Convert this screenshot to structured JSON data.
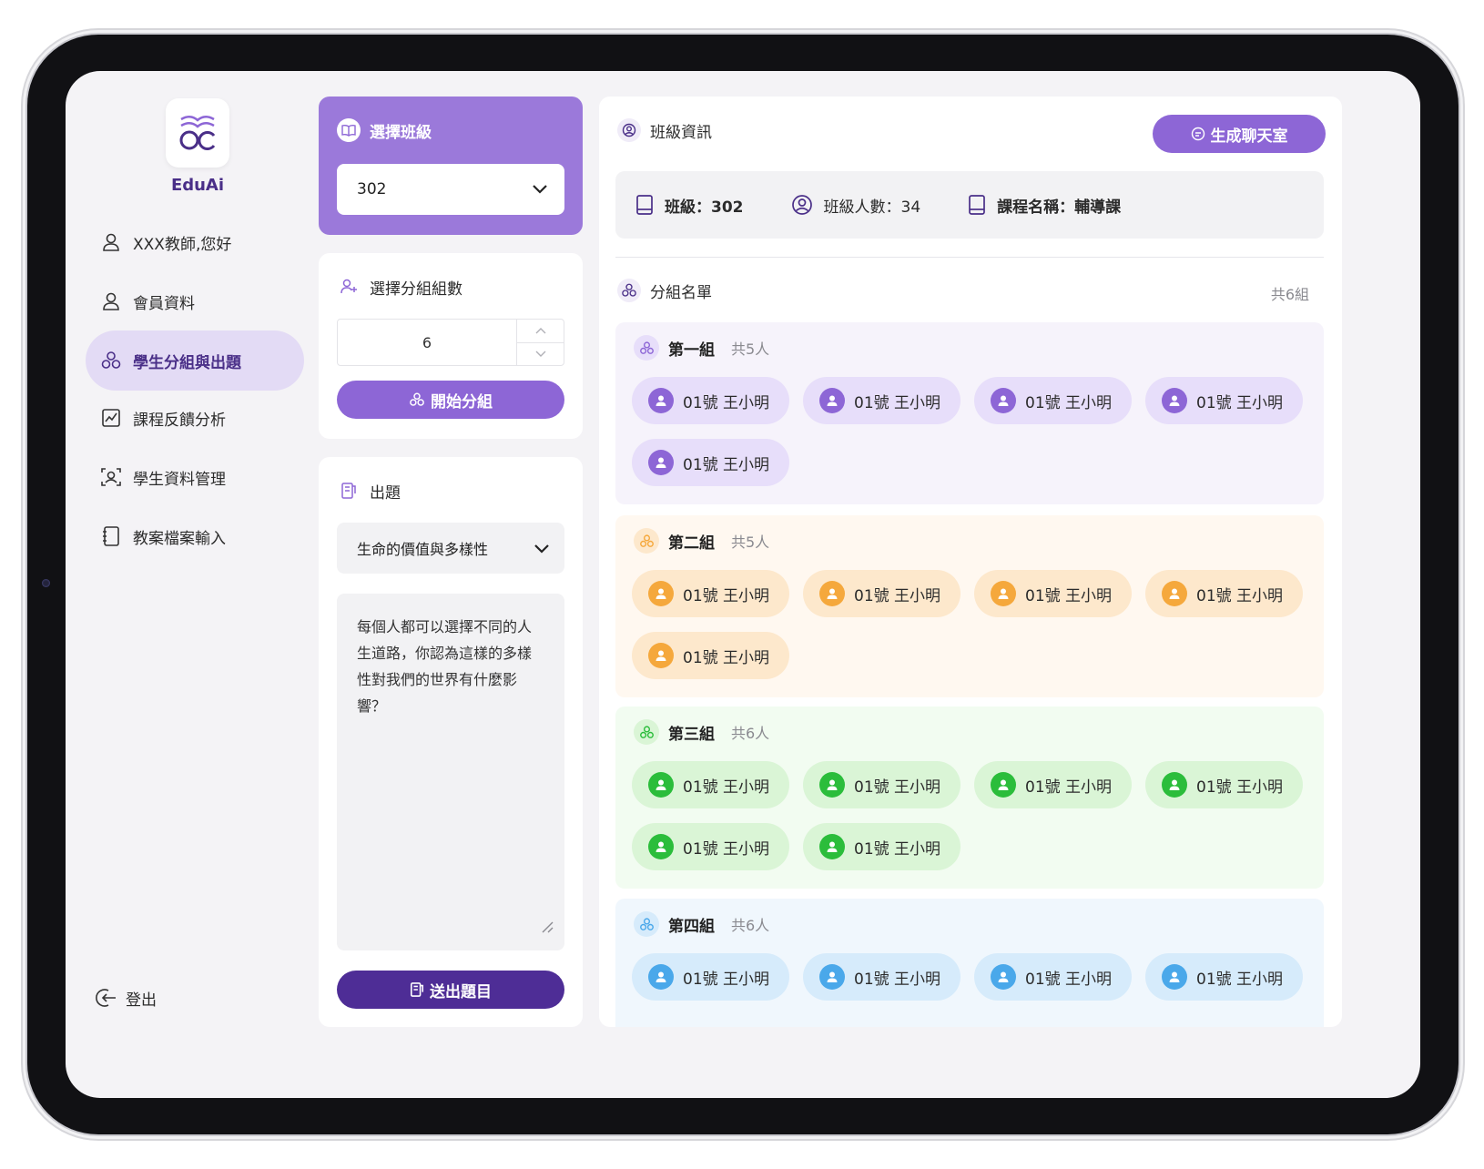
{
  "brand": {
    "name": "EduAi"
  },
  "nav": {
    "greeting": "XXX教師,您好",
    "items": [
      {
        "label": "會員資料",
        "icon": "user-icon"
      },
      {
        "label": "學生分組與出題",
        "icon": "group-icon",
        "active": true
      },
      {
        "label": "課程反饋分析",
        "icon": "chart-icon"
      },
      {
        "label": "學生資料管理",
        "icon": "scan-user-icon"
      },
      {
        "label": "教案檔案輸入",
        "icon": "notebook-icon"
      }
    ],
    "logout": "登出"
  },
  "class_select": {
    "title": "選擇班級",
    "value": "302"
  },
  "group_count": {
    "title": "選擇分組組數",
    "value": "6",
    "start_label": "開始分組"
  },
  "question": {
    "title": "出題",
    "topic": "生命的價值與多樣性",
    "text": "每個人都可以選擇不同的人生道路，你認為這樣的多樣性對我們的世界有什麼影響？",
    "submit_label": "送出題目"
  },
  "class_info": {
    "title": "班級資訊",
    "chat_button": "生成聊天室",
    "class_label": "班級：302",
    "count_label": "班級人數：34",
    "course_label": "課程名稱：輔導課"
  },
  "groups_section": {
    "title": "分組名單",
    "total": "共6組",
    "groups": [
      {
        "name": "第一組",
        "count": "共5人",
        "color": "#8d66d6",
        "bg": "#f6f3fb",
        "chip_bg": "#e7defa",
        "members": [
          "01號 王小明",
          "01號 王小明",
          "01號 王小明",
          "01號 王小明",
          "01號 王小明"
        ]
      },
      {
        "name": "第二組",
        "count": "共5人",
        "color": "#f5a83c",
        "bg": "#fff8f0",
        "chip_bg": "#fde8cc",
        "members": [
          "01號 王小明",
          "01號 王小明",
          "01號 王小明",
          "01號 王小明",
          "01號 王小明"
        ]
      },
      {
        "name": "第三組",
        "count": "共6人",
        "color": "#2bbd3b",
        "bg": "#f2fcf1",
        "chip_bg": "#daf5d6",
        "members": [
          "01號 王小明",
          "01號 王小明",
          "01號 王小明",
          "01號 王小明",
          "01號 王小明",
          "01號 王小明"
        ]
      },
      {
        "name": "第四組",
        "count": "共6人",
        "color": "#4aa8ea",
        "bg": "#f0f7fd",
        "chip_bg": "#d6ebfb",
        "members": [
          "01號 王小明",
          "01號 王小明",
          "01號 王小明",
          "01號 王小明"
        ]
      }
    ]
  }
}
